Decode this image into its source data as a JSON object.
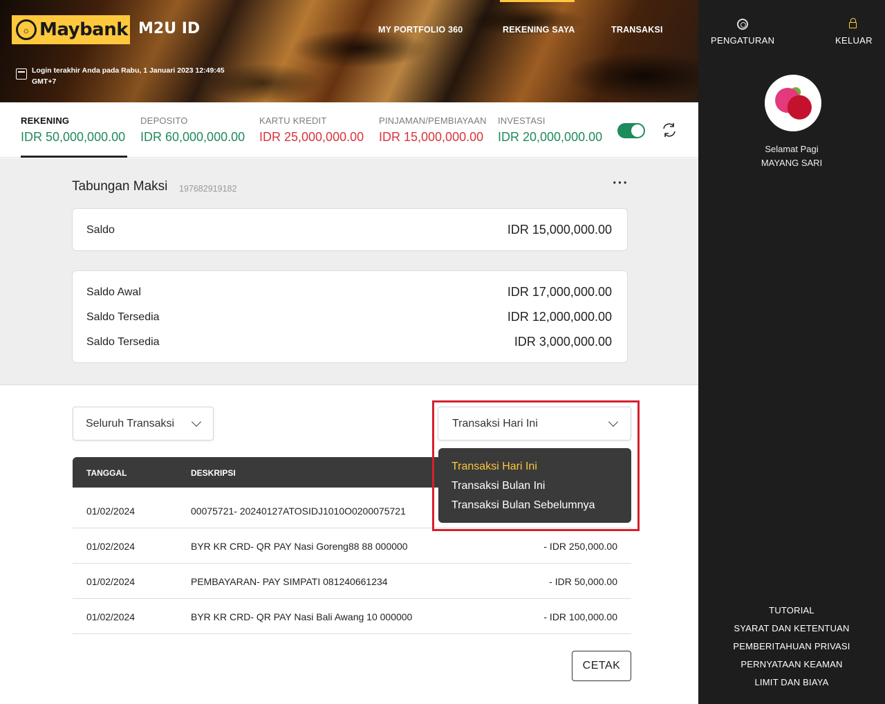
{
  "header": {
    "logo_text": "Maybank",
    "app_name": "M2U ID",
    "nav": [
      "MY PORTFOLIO 360",
      "REKENING SAYA",
      "TRANSAKSI"
    ],
    "login_info": "Login terakhir Anda pada Rabu, 1 Januari 2023 12:49:45 GMT+7"
  },
  "tabs": [
    {
      "label": "REKENING",
      "value": "IDR 50,000,000.00"
    },
    {
      "label": "DEPOSITO",
      "value": "IDR 60,000,000.00"
    },
    {
      "label": "KARTU KREDIT",
      "value": "IDR 25,000,000.00"
    },
    {
      "label": "PINJAMAN/PEMBIAYAAN",
      "value": "IDR 15,000,000.00"
    },
    {
      "label": "INVESTASI",
      "value": "IDR 20,000,000.00"
    }
  ],
  "account": {
    "name": "Tabungan Maksi",
    "number": "197682919182",
    "saldo_label": "Saldo",
    "saldo_value": "IDR 15,000,000.00",
    "details": [
      {
        "label": "Saldo Awal",
        "value": "IDR 17,000,000.00"
      },
      {
        "label": "Saldo Tersedia",
        "value": "IDR 12,000,000.00"
      },
      {
        "label": "Saldo Tersedia",
        "value": "IDR 3,000,000.00"
      }
    ]
  },
  "filters": {
    "type_selected": "Seluruh Transaksi",
    "period_selected": "Transaksi Hari Ini",
    "period_options": [
      "Transaksi Hari Ini",
      "Transaksi Bulan Ini",
      "Transaksi Bulan Sebelumnya"
    ]
  },
  "table": {
    "headers": [
      "TANGGAL",
      "DESKRIPSI"
    ],
    "rows": [
      {
        "date": "01/02/2024",
        "desc": "00075721- 20240127ATOSIDJ1010O0200075721",
        "amount": ""
      },
      {
        "date": "01/02/2024",
        "desc": "BYR KR CRD- QR PAY Nasi Goreng88 88 000000",
        "amount": "- IDR 250,000.00"
      },
      {
        "date": "01/02/2024",
        "desc": "PEMBAYARAN- PAY SIMPATI 081240661234",
        "amount": "- IDR 50,000.00"
      },
      {
        "date": "01/02/2024",
        "desc": "BYR KR CRD- QR PAY Nasi Bali Awang 10 000000",
        "amount": "- IDR 100,000.00"
      }
    ]
  },
  "print_button": "CETAK",
  "sidebar": {
    "settings": "PENGATURAN",
    "logout": "KELUAR",
    "greeting": "Selamat Pagi",
    "user_name": "MAYANG SARI",
    "footer_links": [
      "TUTORIAL",
      "SYARAT DAN KETENTUAN",
      "PEMBERITAHUAN PRIVASI",
      "PERNYATAAN KEAMAN",
      "LIMIT DAN BIAYA"
    ]
  },
  "colors": {
    "brand_yellow": "#ffc83d",
    "positive_green": "#1f8a5b",
    "negative_red": "#d7343b",
    "highlight_red": "#d61f2c"
  }
}
